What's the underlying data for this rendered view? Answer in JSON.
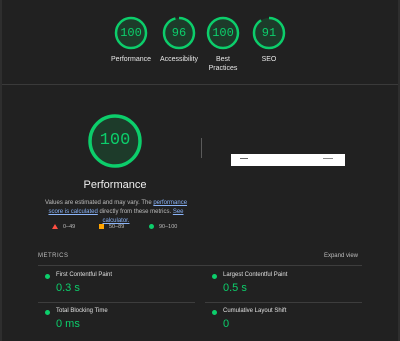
{
  "summary": {
    "gauges": [
      {
        "score": "100",
        "label": "Performance",
        "fraction": 1.0
      },
      {
        "score": "96",
        "label": "Accessibility",
        "fraction": 0.96
      },
      {
        "score": "100",
        "label": "Best Practices",
        "fraction": 1.0
      },
      {
        "score": "91",
        "label": "SEO",
        "fraction": 0.91
      }
    ]
  },
  "performance": {
    "score": "100",
    "fraction": 1.0,
    "title": "Performance",
    "desc_prefix": "Values are estimated and may vary. The ",
    "desc_link1": "performance score is calculated",
    "desc_middle": " directly from these metrics. ",
    "desc_link2": "See calculator."
  },
  "legend": {
    "fail": "0–49",
    "average": "50–89",
    "pass": "90–100"
  },
  "metrics": {
    "heading": "METRICS",
    "expand": "Expand view",
    "items": [
      {
        "name": "First Contentful Paint",
        "value": "0.3 s"
      },
      {
        "name": "Largest Contentful Paint",
        "value": "0.5 s"
      },
      {
        "name": "Total Blocking Time",
        "value": "0 ms"
      },
      {
        "name": "Cumulative Layout Shift",
        "value": "0"
      }
    ]
  },
  "colors": {
    "pass": "#0cce6b",
    "average": "#ffa400",
    "fail": "#ff4e42",
    "background": "#212121"
  }
}
